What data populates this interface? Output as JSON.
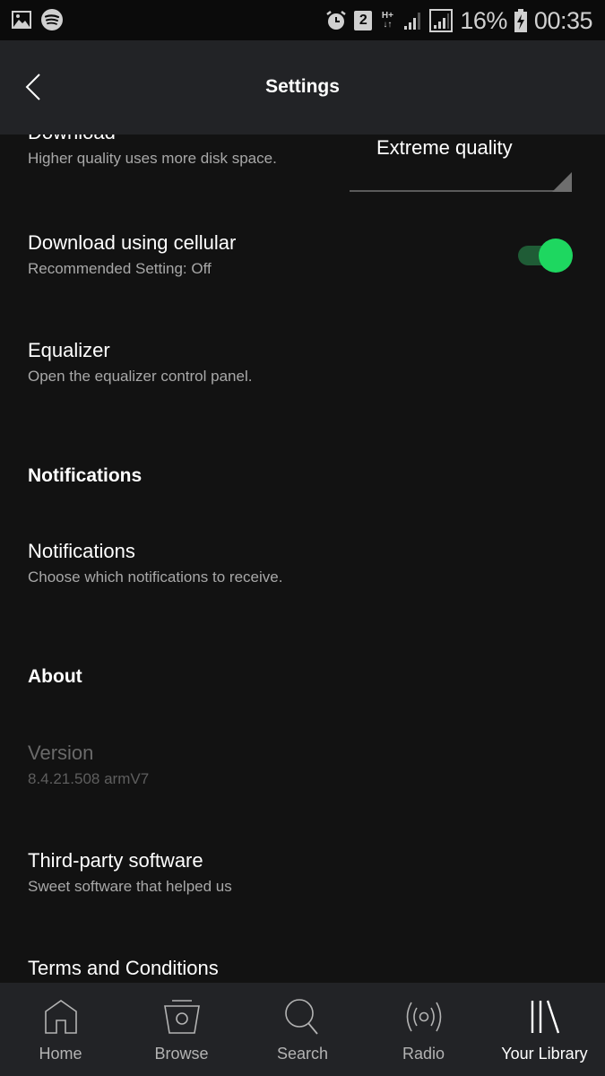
{
  "status_bar": {
    "left_icons": [
      "gallery-icon",
      "spotify-icon"
    ],
    "right_icons": [
      "alarm-icon",
      "sim2-badge",
      "network-hplus-icon",
      "signal-icon",
      "signal-boxed-icon",
      "battery-charging-icon"
    ],
    "sim_badge": "2",
    "network_top": "H+",
    "network_bottom": "↓↑",
    "battery": "16%",
    "time": "00:35"
  },
  "header": {
    "title": "Settings",
    "back_icon": "chevron-left-icon"
  },
  "settings": {
    "download_quality": {
      "title": "Download",
      "subtitle": "Higher quality uses more disk space.",
      "selected": "Extreme quality"
    },
    "download_cellular": {
      "title": "Download using cellular",
      "subtitle": "Recommended Setting: Off",
      "enabled": true
    },
    "equalizer": {
      "title": "Equalizer",
      "subtitle": "Open the equalizer control panel."
    },
    "notifications_section": "Notifications",
    "notifications": {
      "title": "Notifications",
      "subtitle": "Choose which notifications to receive."
    },
    "about_section": "About",
    "version": {
      "title": "Version",
      "subtitle": "8.4.21.508 armV7"
    },
    "third_party": {
      "title": "Third-party software",
      "subtitle": "Sweet software that helped us"
    },
    "terms": {
      "title": "Terms and Conditions"
    }
  },
  "colors": {
    "accent": "#1ed760",
    "background": "#121212",
    "bar": "#222326"
  },
  "bottom_nav": {
    "active": "Your Library",
    "tabs": [
      {
        "label": "Home",
        "icon": "home-icon"
      },
      {
        "label": "Browse",
        "icon": "browse-icon"
      },
      {
        "label": "Search",
        "icon": "search-icon"
      },
      {
        "label": "Radio",
        "icon": "radio-icon"
      },
      {
        "label": "Your Library",
        "icon": "library-icon"
      }
    ]
  }
}
